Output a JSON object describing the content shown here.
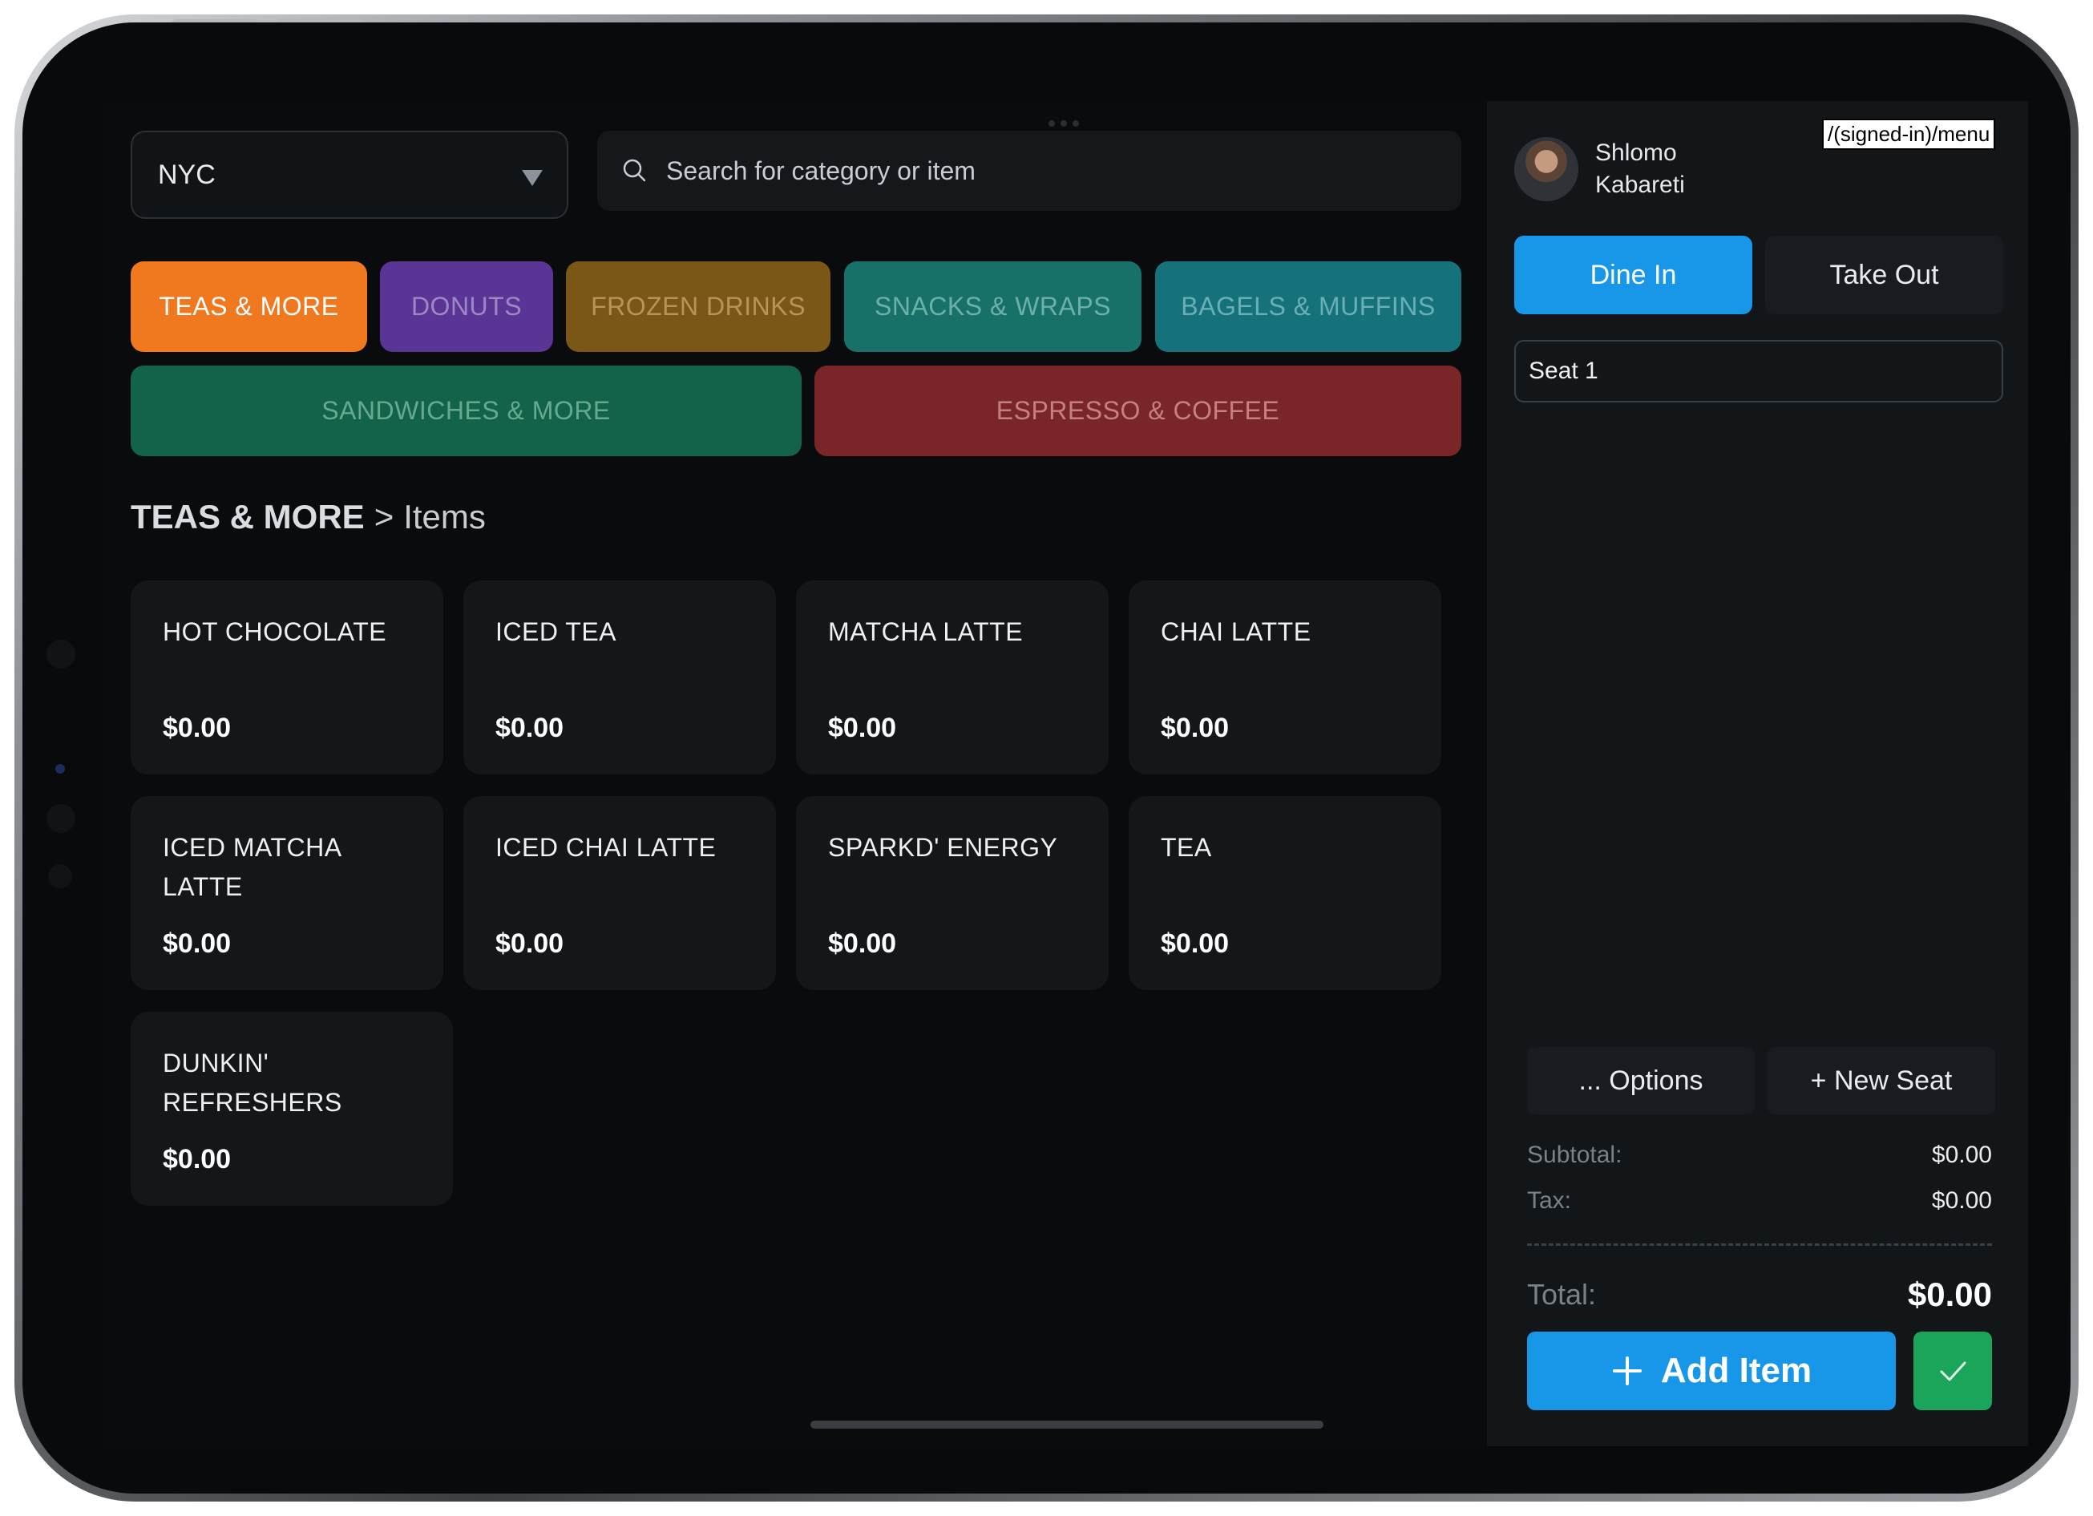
{
  "location": {
    "selected": "NYC"
  },
  "search": {
    "placeholder": "Search for category or item"
  },
  "categories": [
    {
      "label": "TEAS & MORE",
      "bg": "#f0781e",
      "fg": "#ffffff"
    },
    {
      "label": "DONUTS",
      "bg": "#5a3596",
      "fg": "#9b89c4"
    },
    {
      "label": "FROZEN DRINKS",
      "bg": "#7a5717",
      "fg": "#b8945a"
    },
    {
      "label": "SNACKS & WRAPS",
      "bg": "#177168",
      "fg": "#6bb1a8"
    },
    {
      "label": "BAGELS & MUFFINS",
      "bg": "#16727a",
      "fg": "#6aaeb6"
    },
    {
      "label": "SANDWICHES & MORE",
      "bg": "#13634a",
      "fg": "#66a891"
    },
    {
      "label": "ESPRESSO & COFFEE",
      "bg": "#7a2629",
      "fg": "#c48083"
    }
  ],
  "breadcrumb": {
    "category": "TEAS & MORE",
    "separator": ">",
    "section": "Items"
  },
  "items": [
    {
      "name": "HOT CHOCOLATE",
      "price": "$0.00"
    },
    {
      "name": "ICED TEA",
      "price": "$0.00"
    },
    {
      "name": "MATCHA LATTE",
      "price": "$0.00"
    },
    {
      "name": "CHAI LATTE",
      "price": "$0.00"
    },
    {
      "name": "ICED MATCHA LATTE",
      "price": "$0.00"
    },
    {
      "name": "ICED CHAI LATTE",
      "price": "$0.00"
    },
    {
      "name": "SPARKD' ENERGY",
      "price": "$0.00"
    },
    {
      "name": "TEA",
      "price": "$0.00"
    },
    {
      "name": "DUNKIN' REFRESHERS",
      "price": "$0.00"
    }
  ],
  "user": {
    "first_name": "Shlomo",
    "last_name": "Kabareti"
  },
  "route": "/(signed-in)/menu",
  "order_type": {
    "dine_in": "Dine In",
    "take_out": "Take Out",
    "active": "dine_in"
  },
  "seat": {
    "label": "Seat 1"
  },
  "actions": {
    "options": "... Options",
    "new_seat": "+ New Seat",
    "add_item": "Add Item"
  },
  "summary": {
    "subtotal_label": "Subtotal:",
    "subtotal": "$0.00",
    "tax_label": "Tax:",
    "tax": "$0.00",
    "total_label": "Total:",
    "total": "$0.00"
  },
  "colors": {
    "accent": "#1897e8",
    "confirm": "#1aa55a",
    "panel": "#121619",
    "background": "#0a0b0d"
  },
  "icons": [
    "search-icon",
    "chevron-down-icon",
    "plus-icon",
    "check-icon",
    "avatar"
  ]
}
